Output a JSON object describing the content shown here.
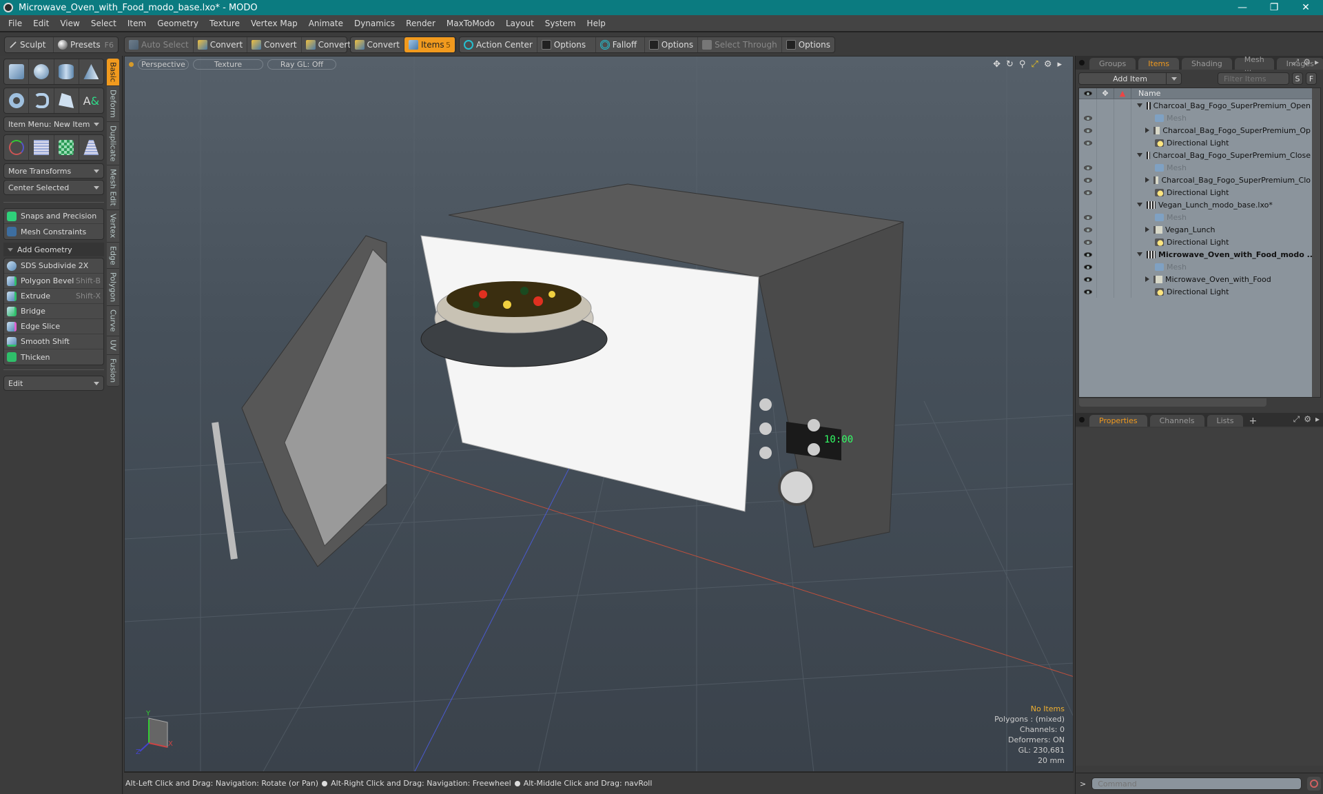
{
  "window": {
    "title": "Microwave_Oven_with_Food_modo_base.lxo* - MODO",
    "controls": [
      "minimize",
      "restore",
      "close"
    ]
  },
  "menu": [
    "File",
    "Edit",
    "View",
    "Select",
    "Item",
    "Geometry",
    "Texture",
    "Vertex Map",
    "Animate",
    "Dynamics",
    "Render",
    "MaxToModo",
    "Layout",
    "System",
    "Help"
  ],
  "toolbar": {
    "sculpt": "Sculpt",
    "presets": "Presets",
    "presets_shortcut": "F6",
    "auto_select": "Auto Select",
    "convert": "Convert",
    "items": "Items",
    "items_count": "5",
    "action_center": "Action Center",
    "options": "Options",
    "falloff": "Falloff",
    "select_through": "Select Through"
  },
  "left_panel": {
    "item_menu": "Item Menu: New Item",
    "more_transforms": "More Transforms",
    "center_selected": "Center Selected",
    "snaps": "Snaps and Precision",
    "mesh_constraints": "Mesh Constraints",
    "add_geometry": "Add Geometry",
    "tools": [
      {
        "label": "SDS Subdivide 2X",
        "shortcut": ""
      },
      {
        "label": "Polygon Bevel",
        "shortcut": "Shift-B"
      },
      {
        "label": "Extrude",
        "shortcut": "Shift-X"
      },
      {
        "label": "Bridge",
        "shortcut": ""
      },
      {
        "label": "Edge Slice",
        "shortcut": ""
      },
      {
        "label": "Smooth Shift",
        "shortcut": ""
      },
      {
        "label": "Thicken",
        "shortcut": ""
      }
    ],
    "edit_dropdown": "Edit",
    "vertical_tabs": [
      "Basic",
      "Deform",
      "Duplicate",
      "Mesh Edit",
      "Vertex",
      "Edge",
      "Polygon",
      "Curve",
      "UV",
      "Fusion"
    ]
  },
  "viewport": {
    "view_mode": "Perspective",
    "shading": "Texture",
    "raygl": "Ray GL: Off",
    "stats": {
      "selection": "No Items",
      "polygons": "Polygons : (mixed)",
      "channels": "Channels: 0",
      "deformers": "Deformers: ON",
      "gl": "GL: 230,681",
      "units": "20 mm"
    },
    "display_time": "10:00"
  },
  "status_bar": {
    "hint1": "Alt-Left Click and Drag: Navigation: Rotate (or Pan)",
    "hint2": "Alt-Right Click and Drag: Navigation: Freewheel",
    "hint3": "Alt-Middle Click and Drag: navRoll"
  },
  "right_panel": {
    "tabs": [
      "Groups",
      "Items",
      "Shading",
      "Mesh ...",
      "Images"
    ],
    "active_tab": "Items",
    "add_item": "Add Item",
    "filter_placeholder": "Filter Items",
    "s_button": "S",
    "f_button": "F",
    "column_name": "Name",
    "tree": [
      {
        "label": "Charcoal_Bag_Fogo_SuperPremium_Open ...",
        "type": "scene",
        "level": 0,
        "expander": "down",
        "eye": "none",
        "style": ""
      },
      {
        "label": "Mesh",
        "type": "mesh",
        "level": 1,
        "expander": "none",
        "eye": "dim",
        "style": "dim"
      },
      {
        "label": "Charcoal_Bag_Fogo_SuperPremium_Op ...",
        "type": "folder",
        "level": 1,
        "expander": "right",
        "eye": "dim",
        "style": ""
      },
      {
        "label": "Directional Light",
        "type": "light",
        "level": 1,
        "expander": "none",
        "eye": "dim",
        "style": ""
      },
      {
        "label": "Charcoal_Bag_Fogo_SuperPremium_Close ...",
        "type": "scene",
        "level": 0,
        "expander": "down",
        "eye": "none",
        "style": ""
      },
      {
        "label": "Mesh",
        "type": "mesh",
        "level": 1,
        "expander": "none",
        "eye": "dim",
        "style": "dim"
      },
      {
        "label": "Charcoal_Bag_Fogo_SuperPremium_Clo ...",
        "type": "folder",
        "level": 1,
        "expander": "right",
        "eye": "dim",
        "style": ""
      },
      {
        "label": "Directional Light",
        "type": "light",
        "level": 1,
        "expander": "none",
        "eye": "dim",
        "style": ""
      },
      {
        "label": "Vegan_Lunch_modo_base.lxo*",
        "type": "scene",
        "level": 0,
        "expander": "down",
        "eye": "none",
        "style": ""
      },
      {
        "label": "Mesh",
        "type": "mesh",
        "level": 1,
        "expander": "none",
        "eye": "dim",
        "style": "dim"
      },
      {
        "label": "Vegan_Lunch",
        "type": "folder",
        "level": 1,
        "expander": "right",
        "eye": "dim",
        "style": ""
      },
      {
        "label": "Directional Light",
        "type": "light",
        "level": 1,
        "expander": "none",
        "eye": "dim",
        "style": ""
      },
      {
        "label": "Microwave_Oven_with_Food_modo ...",
        "type": "scene",
        "level": 0,
        "expander": "down",
        "eye": "dark",
        "style": "bold"
      },
      {
        "label": "Mesh",
        "type": "mesh",
        "level": 1,
        "expander": "none",
        "eye": "dark",
        "style": "dim"
      },
      {
        "label": "Microwave_Oven_with_Food",
        "type": "folder",
        "level": 1,
        "expander": "right",
        "eye": "dark",
        "style": ""
      },
      {
        "label": "Directional Light",
        "type": "light",
        "level": 1,
        "expander": "none",
        "eye": "dark",
        "style": ""
      }
    ],
    "bottom_tabs": [
      "Properties",
      "Channels",
      "Lists"
    ],
    "active_bottom_tab": "Properties",
    "command_placeholder": "Command",
    "command_prompt": ">"
  },
  "colors": {
    "titlebar": "#0b7b80",
    "accent": "#f19a1e",
    "stats_highlight": "#f0b030"
  }
}
